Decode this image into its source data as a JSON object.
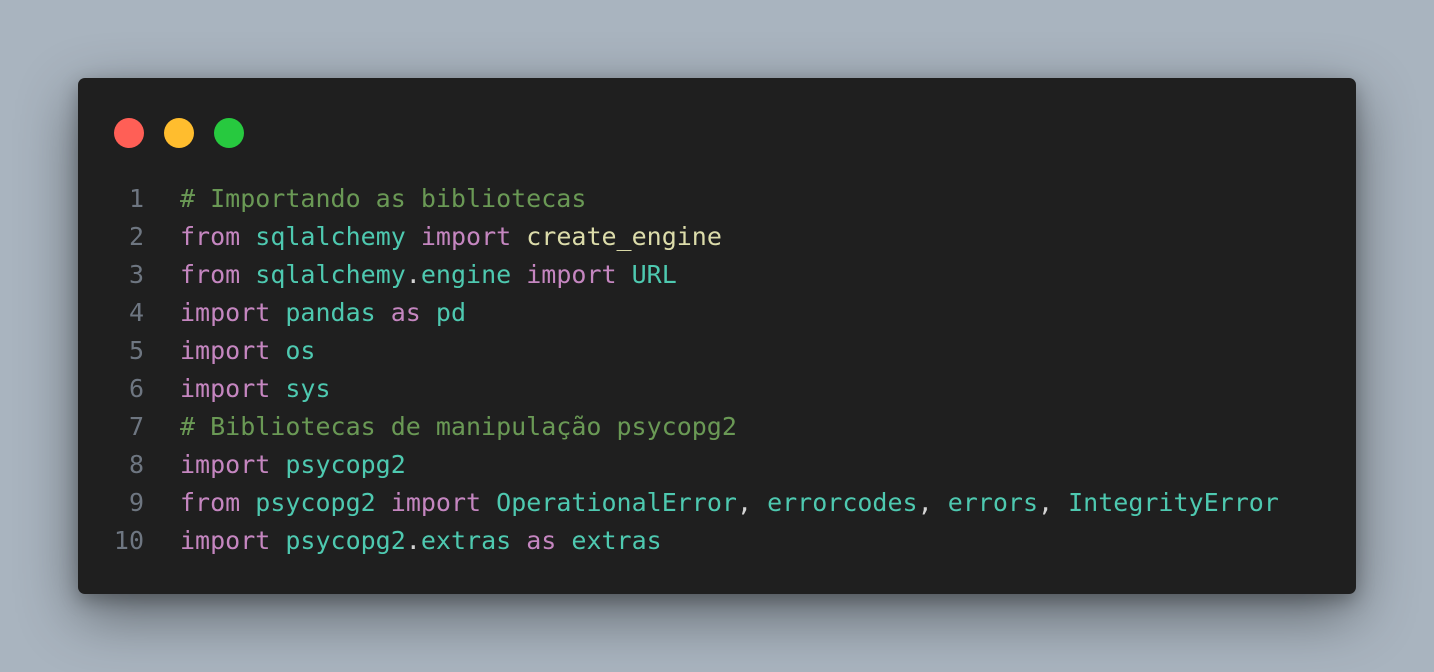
{
  "window": {
    "controls": [
      {
        "name": "close-button",
        "color": "#ff5f56"
      },
      {
        "name": "minimize-button",
        "color": "#ffbd2e"
      },
      {
        "name": "maximize-button",
        "color": "#27c93f"
      }
    ]
  },
  "code": {
    "lines": [
      {
        "number": "1",
        "tokens": [
          {
            "t": "# Importando as bibliotecas",
            "k": "comment"
          }
        ]
      },
      {
        "number": "2",
        "tokens": [
          {
            "t": "from",
            "k": "keyword"
          },
          {
            "t": " ",
            "k": "space"
          },
          {
            "t": "sqlalchemy",
            "k": "module"
          },
          {
            "t": " ",
            "k": "space"
          },
          {
            "t": "import",
            "k": "keyword"
          },
          {
            "t": " ",
            "k": "space"
          },
          {
            "t": "create_engine",
            "k": "func"
          }
        ]
      },
      {
        "number": "3",
        "tokens": [
          {
            "t": "from",
            "k": "keyword"
          },
          {
            "t": " ",
            "k": "space"
          },
          {
            "t": "sqlalchemy",
            "k": "module"
          },
          {
            "t": ".",
            "k": "punct"
          },
          {
            "t": "engine",
            "k": "module"
          },
          {
            "t": " ",
            "k": "space"
          },
          {
            "t": "import",
            "k": "keyword"
          },
          {
            "t": " ",
            "k": "space"
          },
          {
            "t": "URL",
            "k": "module"
          }
        ]
      },
      {
        "number": "4",
        "tokens": [
          {
            "t": "import",
            "k": "keyword"
          },
          {
            "t": " ",
            "k": "space"
          },
          {
            "t": "pandas",
            "k": "module"
          },
          {
            "t": " ",
            "k": "space"
          },
          {
            "t": "as",
            "k": "keyword"
          },
          {
            "t": " ",
            "k": "space"
          },
          {
            "t": "pd",
            "k": "module"
          }
        ]
      },
      {
        "number": "5",
        "tokens": [
          {
            "t": "import",
            "k": "keyword"
          },
          {
            "t": " ",
            "k": "space"
          },
          {
            "t": "os",
            "k": "module"
          }
        ]
      },
      {
        "number": "6",
        "tokens": [
          {
            "t": "import",
            "k": "keyword"
          },
          {
            "t": " ",
            "k": "space"
          },
          {
            "t": "sys",
            "k": "module"
          }
        ]
      },
      {
        "number": "7",
        "tokens": [
          {
            "t": "# Bibliotecas de manipulação psycopg2",
            "k": "comment"
          }
        ]
      },
      {
        "number": "8",
        "tokens": [
          {
            "t": "import",
            "k": "keyword"
          },
          {
            "t": " ",
            "k": "space"
          },
          {
            "t": "psycopg2",
            "k": "module"
          }
        ]
      },
      {
        "number": "9",
        "tokens": [
          {
            "t": "from",
            "k": "keyword"
          },
          {
            "t": " ",
            "k": "space"
          },
          {
            "t": "psycopg2",
            "k": "module"
          },
          {
            "t": " ",
            "k": "space"
          },
          {
            "t": "import",
            "k": "keyword"
          },
          {
            "t": " ",
            "k": "space"
          },
          {
            "t": "OperationalError",
            "k": "module"
          },
          {
            "t": ", ",
            "k": "punct"
          },
          {
            "t": "errorcodes",
            "k": "module"
          },
          {
            "t": ", ",
            "k": "punct"
          },
          {
            "t": "errors",
            "k": "module"
          },
          {
            "t": ", ",
            "k": "punct"
          },
          {
            "t": "IntegrityError",
            "k": "module"
          }
        ]
      },
      {
        "number": "10",
        "tokens": [
          {
            "t": "import",
            "k": "keyword"
          },
          {
            "t": " ",
            "k": "space"
          },
          {
            "t": "psycopg2",
            "k": "module"
          },
          {
            "t": ".",
            "k": "punct"
          },
          {
            "t": "extras",
            "k": "module"
          },
          {
            "t": " ",
            "k": "space"
          },
          {
            "t": "as",
            "k": "keyword"
          },
          {
            "t": " ",
            "k": "space"
          },
          {
            "t": "extras",
            "k": "module"
          }
        ]
      }
    ]
  },
  "colors": {
    "background": "#a9b4bf",
    "window": "#1f1f1f",
    "line_number": "#6e7681",
    "comment": "#6a9955",
    "keyword": "#c586c0",
    "module": "#4ec9b0",
    "func": "#dcdcaa",
    "punct": "#d4d4d4"
  }
}
